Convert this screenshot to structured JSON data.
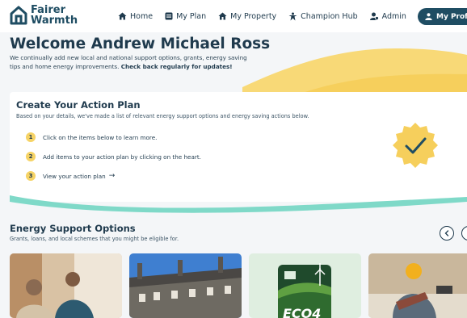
{
  "brand": {
    "line1": "Fairer",
    "line2": "Warmth"
  },
  "nav": {
    "home": "Home",
    "my_plan": "My Plan",
    "my_property": "My Property",
    "champion_hub": "Champion Hub",
    "admin": "Admin",
    "profile": "My Profile"
  },
  "hero": {
    "title": "Welcome Andrew Michael Ross",
    "description": "We continually add new local and national support options, grants, energy saving tips and home energy improvements.",
    "emphasis": "Check back regularly for updates!"
  },
  "action_plan": {
    "title": "Create Your Action Plan",
    "subtitle": "Based on your details, we've made a list of relevant energy support options and energy saving actions below.",
    "steps": [
      {
        "number": "1",
        "text": "Click on the items below to learn more."
      },
      {
        "number": "2",
        "text": "Add items to your action plan by clicking on the heart."
      },
      {
        "number": "3",
        "text": "View your action plan"
      }
    ]
  },
  "energy_support": {
    "title": "Energy Support Options",
    "subtitle": "Grants, loans, and local schemes that you might be eligible for."
  },
  "icons": {
    "logo": "house-logo-icon",
    "home": "home-icon",
    "my_plan": "plan-icon",
    "my_property": "property-icon",
    "champion_hub": "champion-icon",
    "admin": "admin-icon",
    "settings": "gear-icon",
    "profile": "user-icon",
    "badge": "check-badge-icon",
    "prev": "chevron-left-icon"
  },
  "colors": {
    "primary": "#1f4d63",
    "accent_yellow": "#f6d365",
    "teal": "#7fd9c8"
  }
}
